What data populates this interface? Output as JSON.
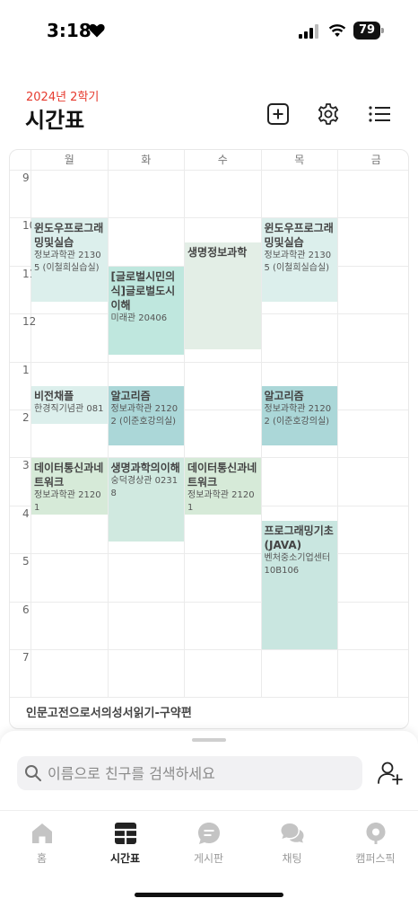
{
  "status_bar": {
    "time": "3:18",
    "battery": "79"
  },
  "header": {
    "semester": "2024년 2학기",
    "title": "시간표"
  },
  "timetable": {
    "days": [
      "월",
      "화",
      "수",
      "목",
      "금"
    ],
    "hours": [
      "9",
      "10",
      "11",
      "12",
      "1",
      "2",
      "3",
      "4",
      "5",
      "6",
      "7"
    ],
    "courses": [
      {
        "name": "윈도우프로그래밍및실습",
        "room": "정보과학관 21305 (이철희실습실)",
        "day": 0,
        "start": 10.0,
        "end": 11.75,
        "color": "#dcefec"
      },
      {
        "name": "비전채플",
        "room": "한경직기념관 081",
        "day": 0,
        "start": 13.5,
        "end": 14.3,
        "color": "#dcefec"
      },
      {
        "name": "데이터통신과네트워크",
        "room": "정보과학관 21201",
        "day": 0,
        "start": 15.0,
        "end": 16.2,
        "color": "#d6ead8"
      },
      {
        "name": "[글로벌시민의식]글로벌도시이해",
        "room": "미래관 20406",
        "day": 1,
        "start": 11.0,
        "end": 12.85,
        "color": "#bfe7de"
      },
      {
        "name": "알고리즘",
        "room": "정보과학관 21202 (이준호강의실)",
        "day": 1,
        "start": 13.5,
        "end": 14.75,
        "color": "#abd7d8"
      },
      {
        "name": "생명과학의이해",
        "room": "숭덕경상관 02318",
        "day": 1,
        "start": 15.0,
        "end": 16.75,
        "color": "#d0e9e0"
      },
      {
        "name": "생명정보과학",
        "room": "",
        "day": 2,
        "start": 10.5,
        "end": 12.75,
        "color": "#e3eee6"
      },
      {
        "name": "데이터통신과네트워크",
        "room": "정보과학관 21201",
        "day": 2,
        "start": 15.0,
        "end": 16.2,
        "color": "#d6ead8"
      },
      {
        "name": "윈도우프로그래밍및실습",
        "room": "정보과학관 21305 (이철희실습실)",
        "day": 3,
        "start": 10.0,
        "end": 11.75,
        "color": "#dcefec"
      },
      {
        "name": "알고리즘",
        "room": "정보과학관 21202 (이준호강의실)",
        "day": 3,
        "start": 13.5,
        "end": 14.75,
        "color": "#abd7d8"
      },
      {
        "name": "프로그래밍기초(JAVA)",
        "room": "벤처중소기업센터 10B106",
        "day": 3,
        "start": 16.3,
        "end": 19.0,
        "color": "#c9e6e0"
      }
    ],
    "extra_course": "인문고전으로서의성서읽기-구약편"
  },
  "search": {
    "placeholder": "이름으로 친구를 검색하세요"
  },
  "tabs": [
    {
      "label": "홈",
      "icon": "home-icon"
    },
    {
      "label": "시간표",
      "icon": "timetable-icon"
    },
    {
      "label": "게시판",
      "icon": "board-icon"
    },
    {
      "label": "채팅",
      "icon": "chat-icon"
    },
    {
      "label": "캠퍼스픽",
      "icon": "campuspick-icon"
    }
  ],
  "active_tab": 1,
  "colors": {
    "accent": "#e63a2e",
    "inactive": "#9b9b9b",
    "active": "#222222"
  }
}
